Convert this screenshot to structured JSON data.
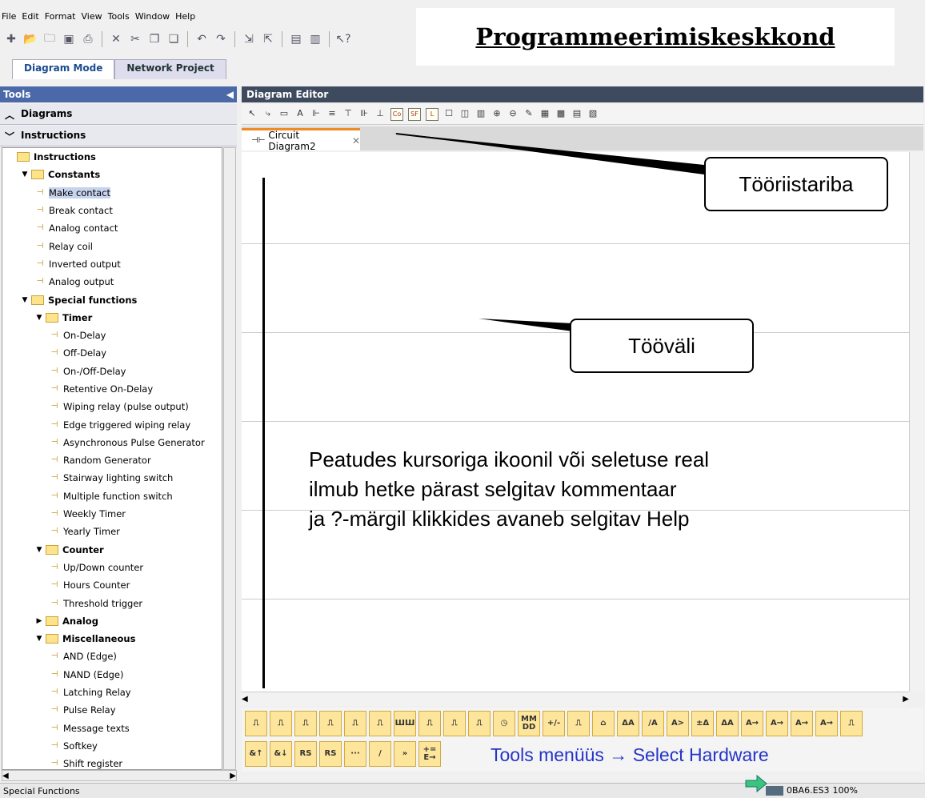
{
  "menu": [
    "File",
    "Edit",
    "Format",
    "View",
    "Tools",
    "Window",
    "Help"
  ],
  "title": "Programmeerimiskeskkond",
  "mode_tabs": [
    "Diagram Mode",
    "Network Project"
  ],
  "tools_panel": {
    "header": "Tools",
    "sections": [
      "Diagrams",
      "Instructions"
    ]
  },
  "tree": [
    {
      "label": "Instructions",
      "level": 0,
      "kind": "folder",
      "bold": true
    },
    {
      "label": "Constants",
      "level": 1,
      "kind": "folder",
      "bold": true,
      "open": true
    },
    {
      "label": "Make contact",
      "level": 2,
      "kind": "leaf",
      "selected": true
    },
    {
      "label": "Break contact",
      "level": 2,
      "kind": "leaf"
    },
    {
      "label": "Analog contact",
      "level": 2,
      "kind": "leaf"
    },
    {
      "label": "Relay coil",
      "level": 2,
      "kind": "leaf"
    },
    {
      "label": "Inverted output",
      "level": 2,
      "kind": "leaf"
    },
    {
      "label": "Analog output",
      "level": 2,
      "kind": "leaf"
    },
    {
      "label": "Special functions",
      "level": 1,
      "kind": "folder",
      "bold": true,
      "open": true
    },
    {
      "label": "Timer",
      "level": 2,
      "kind": "folder",
      "bold": true,
      "open": true
    },
    {
      "label": "On-Delay",
      "level": 3,
      "kind": "leaf"
    },
    {
      "label": "Off-Delay",
      "level": 3,
      "kind": "leaf"
    },
    {
      "label": "On-/Off-Delay",
      "level": 3,
      "kind": "leaf"
    },
    {
      "label": "Retentive On-Delay",
      "level": 3,
      "kind": "leaf"
    },
    {
      "label": "Wiping relay (pulse output)",
      "level": 3,
      "kind": "leaf"
    },
    {
      "label": "Edge triggered wiping relay",
      "level": 3,
      "kind": "leaf"
    },
    {
      "label": "Asynchronous Pulse Generator",
      "level": 3,
      "kind": "leaf"
    },
    {
      "label": "Random Generator",
      "level": 3,
      "kind": "leaf"
    },
    {
      "label": "Stairway lighting switch",
      "level": 3,
      "kind": "leaf"
    },
    {
      "label": "Multiple function switch",
      "level": 3,
      "kind": "leaf"
    },
    {
      "label": "Weekly Timer",
      "level": 3,
      "kind": "leaf"
    },
    {
      "label": "Yearly Timer",
      "level": 3,
      "kind": "leaf"
    },
    {
      "label": "Counter",
      "level": 2,
      "kind": "folder",
      "bold": true,
      "open": true
    },
    {
      "label": "Up/Down counter",
      "level": 3,
      "kind": "leaf"
    },
    {
      "label": "Hours Counter",
      "level": 3,
      "kind": "leaf"
    },
    {
      "label": "Threshold trigger",
      "level": 3,
      "kind": "leaf"
    },
    {
      "label": "Analog",
      "level": 2,
      "kind": "folder",
      "bold": true,
      "open": false
    },
    {
      "label": "Miscellaneous",
      "level": 2,
      "kind": "folder",
      "bold": true,
      "open": true
    },
    {
      "label": "AND (Edge)",
      "level": 3,
      "kind": "leaf"
    },
    {
      "label": "NAND (Edge)",
      "level": 3,
      "kind": "leaf"
    },
    {
      "label": "Latching Relay",
      "level": 3,
      "kind": "leaf"
    },
    {
      "label": "Pulse Relay",
      "level": 3,
      "kind": "leaf"
    },
    {
      "label": "Message texts",
      "level": 3,
      "kind": "leaf"
    },
    {
      "label": "Softkey",
      "level": 3,
      "kind": "leaf"
    },
    {
      "label": "Shift register",
      "level": 3,
      "kind": "leaf"
    }
  ],
  "editor": {
    "header": "Diagram Editor",
    "tab": "Circuit Diagram2"
  },
  "palette_row1": [
    "⎍",
    "⎍",
    "⎍",
    "⎍",
    "⎍",
    "⎍",
    "ШШ",
    "⎍",
    "⎍",
    "⎍",
    "◷",
    "MM DD",
    "+/-",
    "⎍",
    "⌂",
    "ΔA",
    "/A",
    "A>",
    "±Δ",
    "ΔA",
    "A→",
    "A→",
    "A→",
    "A→",
    "⎍"
  ],
  "palette_row2": [
    "&↑",
    "&↓",
    "RS",
    "RS",
    "···",
    "/",
    "»",
    "+= E→"
  ],
  "annotations": {
    "toolbar_label": "Tööriistariba",
    "workspace_label": "Tööväli",
    "hint_lines": [
      "Peatudes kursoriga ikoonil või seletuse real",
      "ilmub hetke pärast selgitav kommentaar",
      "ja ?-märgil klikkides avaneb selgitav Help"
    ],
    "hardware_hint": "Tools menüüs → Select Hardware"
  },
  "status": {
    "left": "Special Functions",
    "device": "0BA6.ES3",
    "zoom": "100%"
  }
}
